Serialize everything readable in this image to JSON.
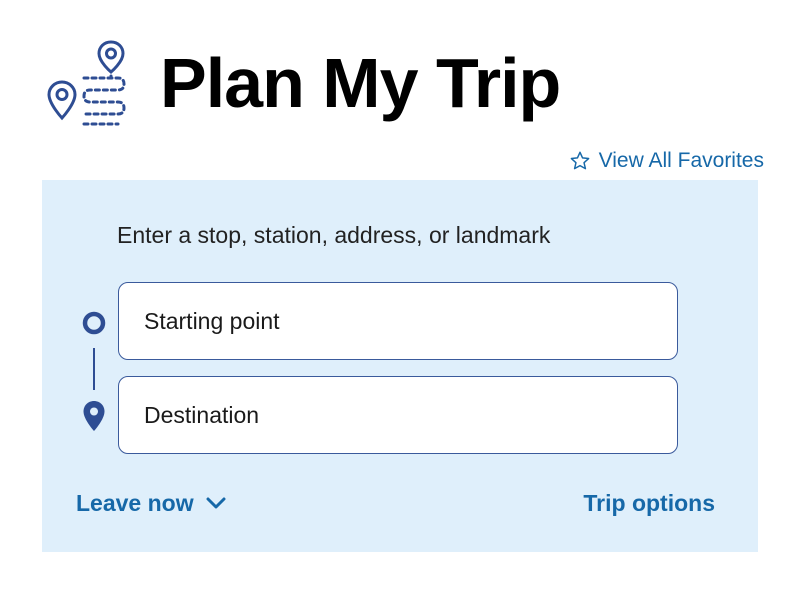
{
  "header": {
    "title": "Plan My Trip",
    "icon": "trip-route-icon"
  },
  "favorites": {
    "label": "View All Favorites",
    "icon": "star-outline-icon"
  },
  "planner": {
    "instruction": "Enter a stop, station, address, or landmark",
    "start": {
      "placeholder": "Starting point",
      "value": "",
      "icon": "circle-marker-icon"
    },
    "destination": {
      "placeholder": "Destination",
      "value": "",
      "icon": "map-pin-icon"
    },
    "leave_time": {
      "label": "Leave now",
      "icon": "chevron-down-icon"
    },
    "trip_options_label": "Trip options"
  },
  "colors": {
    "accent": "#1668a8",
    "icon_blue": "#2e4d93",
    "panel_bg": "#dfeffb",
    "title": "#000000"
  }
}
